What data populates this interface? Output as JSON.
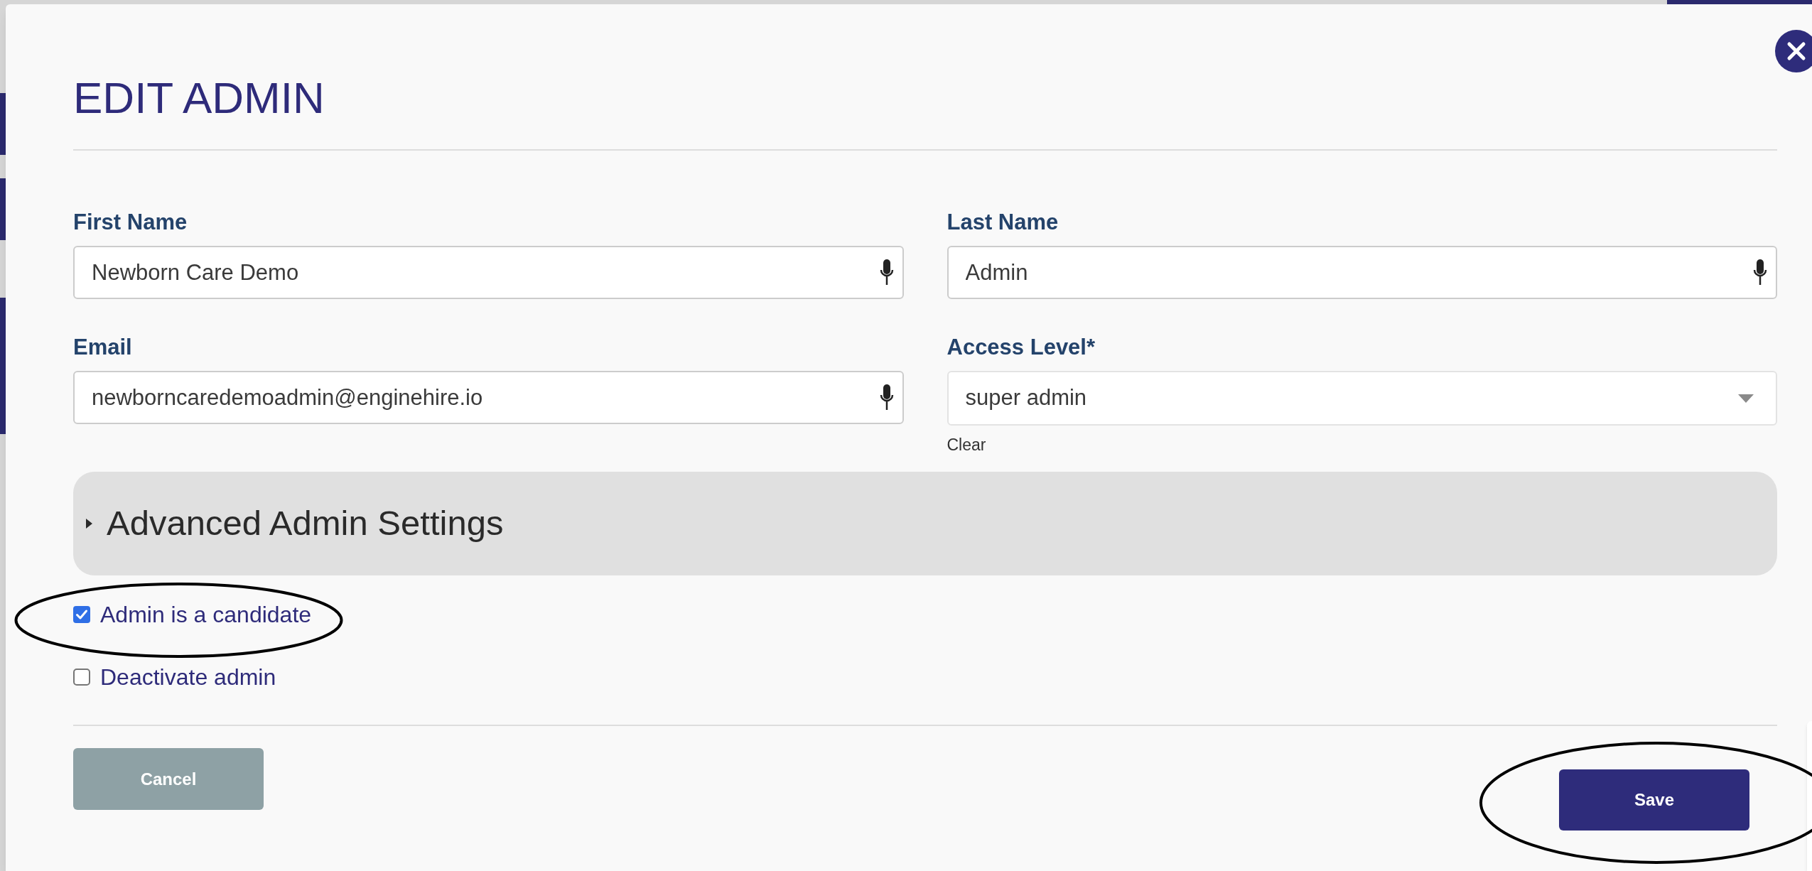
{
  "modal": {
    "title": "EDIT ADMIN"
  },
  "fields": [
    {
      "kind": "text",
      "label": "First Name",
      "value": "Newborn Care Demo"
    },
    {
      "kind": "text",
      "label": "Last Name",
      "value": "Admin"
    },
    {
      "kind": "text",
      "label": "Email",
      "value": "newborncaredemoadmin@enginehire.io"
    },
    {
      "kind": "select",
      "label": "Access Level*",
      "value": "super admin",
      "clear": "Clear"
    }
  ],
  "advanced_settings": {
    "label": "Advanced Admin Settings",
    "expanded": false
  },
  "checkboxes": [
    {
      "label": "Admin is a candidate",
      "checked": true,
      "circled": true
    },
    {
      "label": "Deactivate admin",
      "checked": false,
      "circled": false
    }
  ],
  "buttons": [
    {
      "kind": "cancel",
      "label": "Cancel",
      "circled": false
    },
    {
      "kind": "save",
      "label": "Save",
      "circled": true
    }
  ]
}
